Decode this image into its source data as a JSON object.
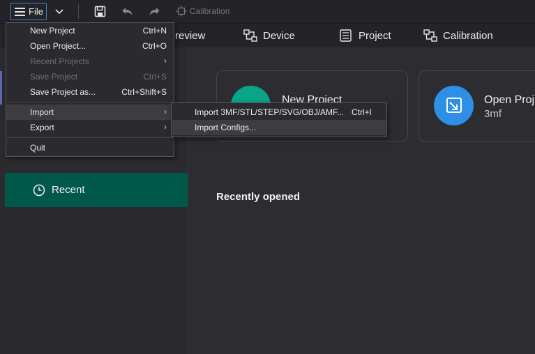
{
  "toolbar": {
    "file_label": "File",
    "calibration_label": "Calibration"
  },
  "tabs": [
    {
      "label": "review"
    },
    {
      "label": "Device"
    },
    {
      "label": "Project"
    },
    {
      "label": "Calibration"
    }
  ],
  "sidebar": {
    "recent_label": "Recent"
  },
  "main": {
    "new_project": {
      "title": "New Project"
    },
    "open_project": {
      "title": "Open Proj",
      "subtitle": "3mf"
    },
    "recently_opened": "Recently opened"
  },
  "file_menu": {
    "items": [
      {
        "label": "New Project",
        "shortcut": "Ctrl+N"
      },
      {
        "label": "Open Project...",
        "shortcut": "Ctrl+O"
      },
      {
        "label": "Recent Projects",
        "shortcut": ""
      },
      {
        "label": "Save Project",
        "shortcut": "Ctrl+S"
      },
      {
        "label": "Save Project as...",
        "shortcut": "Ctrl+Shift+S"
      },
      {
        "label": "Import",
        "shortcut": ""
      },
      {
        "label": "Export",
        "shortcut": ""
      },
      {
        "label": "Quit",
        "shortcut": ""
      }
    ]
  },
  "import_submenu": {
    "items": [
      {
        "label": "Import 3MF/STL/STEP/SVG/OBJ/AMF...",
        "shortcut": "Ctrl+I"
      },
      {
        "label": "Import Configs...",
        "shortcut": ""
      }
    ]
  },
  "colors": {
    "accent_green": "#00584a",
    "new_project_circle": "#0aa488",
    "open_project_circle": "#2d8fe6",
    "focus_border": "#3f86c9"
  },
  "icons": [
    "hamburger-icon",
    "chevron-down-icon",
    "save-icon",
    "undo-icon",
    "redo-icon",
    "calibration-icon",
    "device-icon",
    "project-icon",
    "clock-icon",
    "folder-open-icon"
  ]
}
